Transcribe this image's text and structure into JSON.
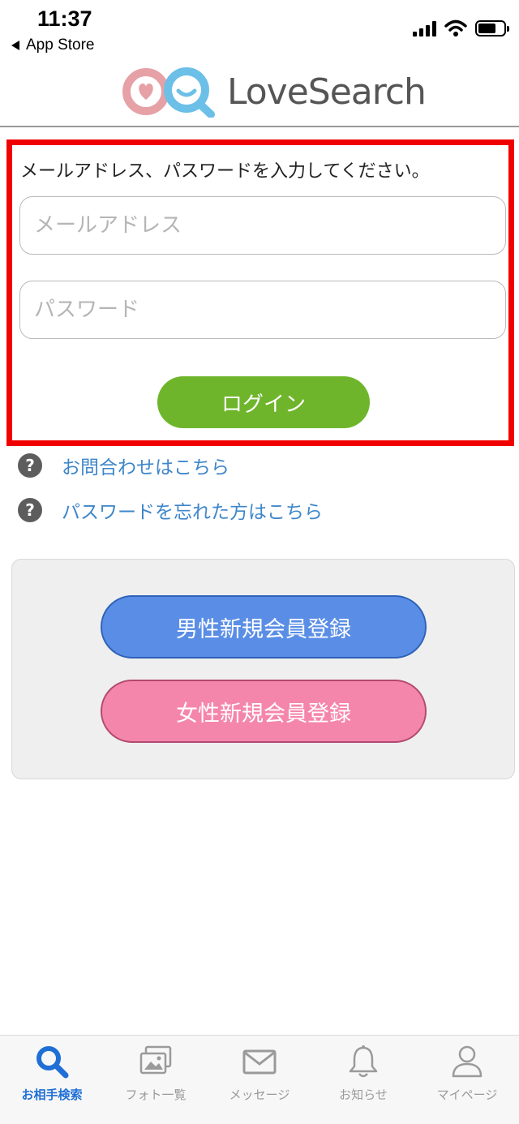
{
  "status_bar": {
    "time": "11:37",
    "back_app": "App Store"
  },
  "header": {
    "logo_text": "LoveSearch",
    "logo_colors": {
      "heart": "#e6a1a6",
      "search": "#6cc0e8"
    }
  },
  "login": {
    "instruction": "メールアドレス、パスワードを入力してください。",
    "email_placeholder": "メールアドレス",
    "email_value": "",
    "password_placeholder": "パスワード",
    "password_value": "",
    "login_label": "ログイン",
    "highlight_color": "#f00000",
    "login_color": "#6fb52c"
  },
  "help_links": {
    "contact": "お問合わせはこちら",
    "forgot_password": "パスワードを忘れた方はこちら",
    "icon": "question-circle-icon"
  },
  "register": {
    "male_label": "男性新規会員登録",
    "female_label": "女性新規会員登録",
    "male_color": "#5a8ee6",
    "female_color": "#f586ab"
  },
  "tab_bar": {
    "tabs": [
      {
        "label": "お相手検索",
        "icon": "search-icon",
        "active": true
      },
      {
        "label": "フォト一覧",
        "icon": "photo-icon",
        "active": false
      },
      {
        "label": "メッセージ",
        "icon": "mail-icon",
        "active": false
      },
      {
        "label": "お知らせ",
        "icon": "bell-icon",
        "active": false
      },
      {
        "label": "マイページ",
        "icon": "user-icon",
        "active": false
      }
    ],
    "active_color": "#1f6fd6",
    "inactive_color": "#9a9a9a"
  }
}
